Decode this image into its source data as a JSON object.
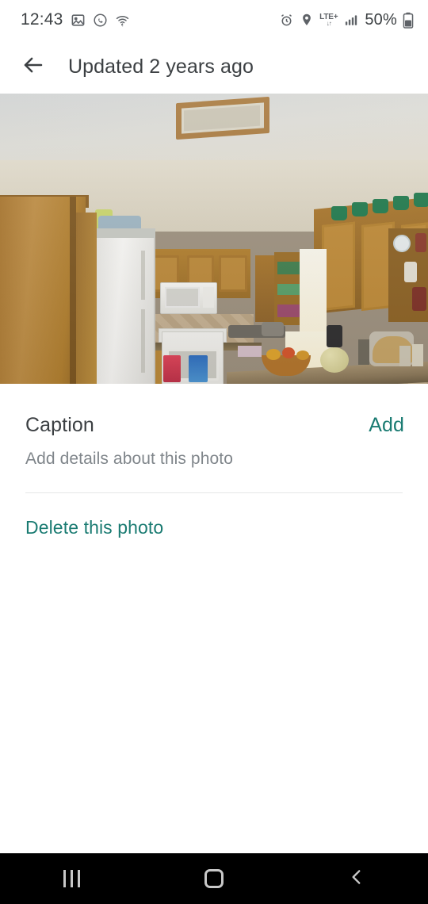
{
  "status_bar": {
    "time": "12:43",
    "battery_percent": "50%",
    "network_type": "LTE+",
    "icons": [
      "gallery-icon",
      "whatsapp-icon",
      "wifi-question-icon",
      "alarm-icon",
      "location-icon",
      "signal-bars-icon",
      "battery-icon"
    ]
  },
  "app_bar": {
    "back_icon": "back-arrow-icon",
    "title": "Updated 2 years ago"
  },
  "photo": {
    "alt": "Kitchen interior with wooden cabinets, white refrigerator, white stove, microwave and tiled island counter",
    "edit_icon": "pencil-icon"
  },
  "caption_section": {
    "label": "Caption",
    "action_label": "Add",
    "hint": "Add details about this photo"
  },
  "actions": {
    "delete_label": "Delete this photo"
  },
  "nav_bar": {
    "recents": "recents-icon",
    "home": "home-icon",
    "back": "back-icon"
  },
  "colors": {
    "accent_teal": "#1a7b72",
    "primary_text": "#3c4043",
    "secondary_text": "#80868b",
    "nav_background": "#000000"
  }
}
